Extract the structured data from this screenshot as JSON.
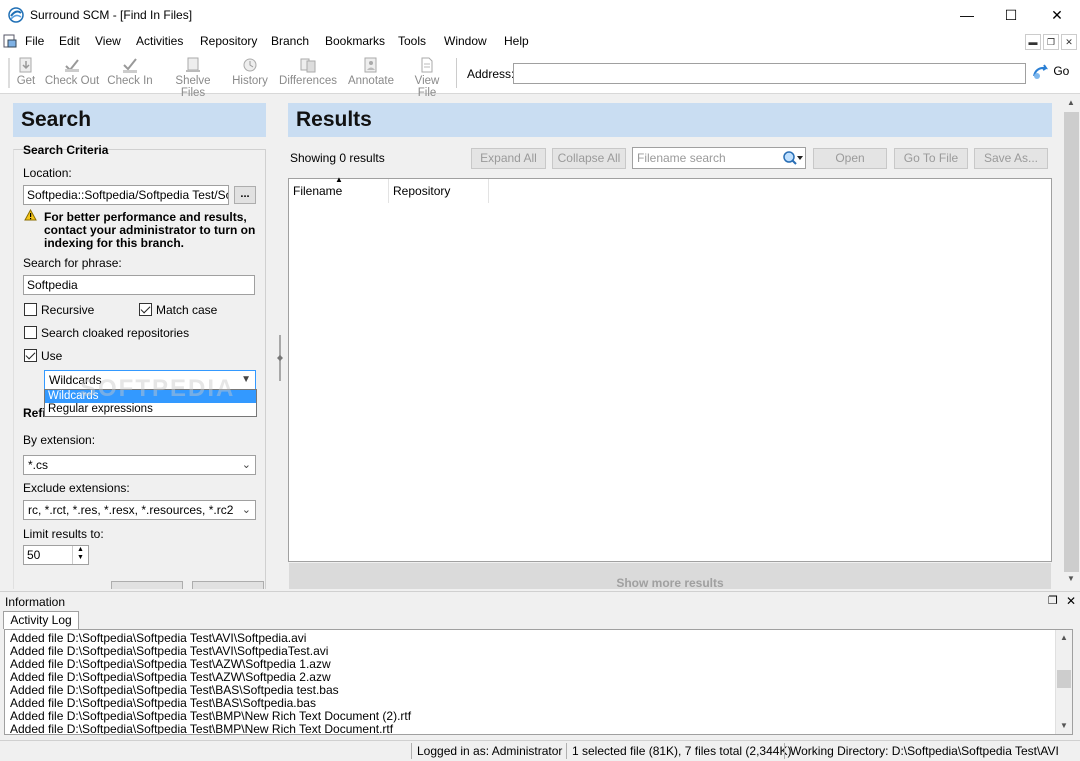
{
  "window": {
    "title": "Surround SCM - [Find In Files]",
    "controls": {
      "minimize": "—",
      "maximize": "☐",
      "close": "✕"
    }
  },
  "menu": [
    "File",
    "Edit",
    "View",
    "Activities",
    "Repository",
    "Branch",
    "Bookmarks",
    "Tools",
    "Window",
    "Help"
  ],
  "toolbar": {
    "buttons": [
      "Get",
      "Check Out",
      "Check In",
      "Shelve Files",
      "History",
      "Differences",
      "Annotate",
      "View File"
    ],
    "address_label": "Address:",
    "address_value": "",
    "go_label": "Go"
  },
  "search": {
    "header": "Search",
    "criteria_title": "Search Criteria",
    "location_label": "Location:",
    "location_value": "Softpedia::Softpedia/Softpedia Test/Softp",
    "browse_label": "...",
    "warning": "For better performance and results, contact your administrator to turn on indexing for this branch.",
    "phrase_label": "Search for phrase:",
    "phrase_value": "Softpedia",
    "recursive_label": "Recursive",
    "recursive_checked": false,
    "match_case_label": "Match case",
    "match_case_checked": true,
    "cloaked_label": "Search cloaked repositories",
    "cloaked_checked": false,
    "use_label": "Use",
    "use_checked": true,
    "use_selected": "Wildcards",
    "use_options": [
      "Wildcards",
      "Regular expressions"
    ],
    "refine_title": "Refi",
    "by_extension_label": "By extension:",
    "by_extension_value": "*.cs",
    "exclude_label": "Exclude extensions:",
    "exclude_value": "rc, *.rct, *.res, *.resx, *.resources, *.rc2",
    "limit_label": "Limit results to:",
    "limit_value": "50"
  },
  "results": {
    "header": "Results",
    "count_text": "Showing 0 results",
    "expand_all": "Expand All",
    "collapse_all": "Collapse All",
    "filename_search_placeholder": "Filename search",
    "open": "Open",
    "go_to_file": "Go To File",
    "save_as": "Save As...",
    "columns": [
      "Filename",
      "Repository"
    ],
    "show_more": "Show more results"
  },
  "info": {
    "title": "Information",
    "tab": "Activity Log",
    "log": [
      "Added file D:\\Softpedia\\Softpedia Test\\AVI\\Softpedia.avi",
      "Added file D:\\Softpedia\\Softpedia Test\\AVI\\SoftpediaTest.avi",
      "Added file D:\\Softpedia\\Softpedia Test\\AZW\\Softpedia 1.azw",
      "Added file D:\\Softpedia\\Softpedia Test\\AZW\\Softpedia 2.azw",
      "Added file D:\\Softpedia\\Softpedia Test\\BAS\\Softpedia test.bas",
      "Added file D:\\Softpedia\\Softpedia Test\\BAS\\Softpedia.bas",
      "Added file D:\\Softpedia\\Softpedia Test\\BMP\\New Rich Text Document (2).rtf",
      "Added file D:\\Softpedia\\Softpedia Test\\BMP\\New Rich Text Document.rtf"
    ]
  },
  "status": {
    "logged_in": "Logged in as: Administrator",
    "selection": "1 selected file (81K), 7 files total (2,344K)",
    "working_dir": "Working Directory: D:\\Softpedia\\Softpedia Test\\AVI"
  },
  "watermark": "SOFTPEDIA",
  "colors": {
    "panel_header": "#c9ddf2",
    "selection": "#3399ff"
  }
}
